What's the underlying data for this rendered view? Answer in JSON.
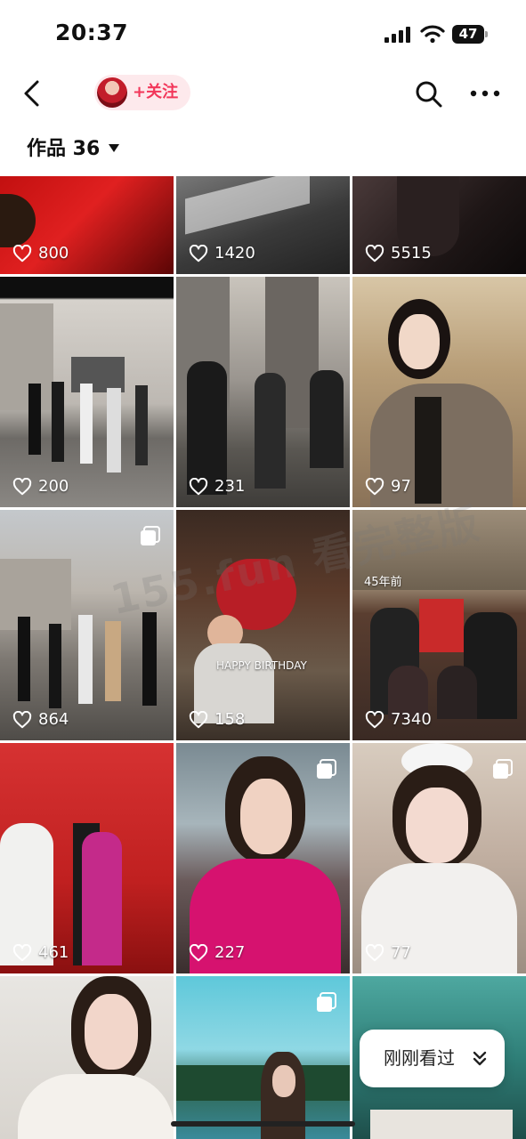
{
  "status_bar": {
    "time": "20:37",
    "battery": "47"
  },
  "nav": {
    "follow_label": "+关注",
    "icons": [
      "back-arrow-icon",
      "avatar",
      "search-icon",
      "more-dots-icon"
    ]
  },
  "works": {
    "label": "作品 36"
  },
  "grid": [
    {
      "likes": "800",
      "multi": false
    },
    {
      "likes": "1420",
      "multi": false
    },
    {
      "likes": "5515",
      "multi": false
    },
    {
      "likes": "200",
      "multi": false
    },
    {
      "likes": "231",
      "multi": false
    },
    {
      "likes": "97",
      "multi": false
    },
    {
      "likes": "864",
      "multi": true
    },
    {
      "likes": "158",
      "multi": false,
      "overlay": "HAPPY BIRTHDAY"
    },
    {
      "likes": "7340",
      "multi": false,
      "overlay": "45年前"
    },
    {
      "likes": "461",
      "multi": false
    },
    {
      "likes": "227",
      "multi": true
    },
    {
      "likes": "77",
      "multi": true
    },
    {
      "likes": "",
      "multi": false
    },
    {
      "likes": "",
      "multi": true
    },
    {
      "likes": "",
      "multi": false
    }
  ],
  "recent": {
    "label": "刚刚看过"
  },
  "watermark": "155.fun 看完整版",
  "colors": {
    "accent": "#f2375a",
    "follow_chip_bg": "#fde9ec"
  }
}
